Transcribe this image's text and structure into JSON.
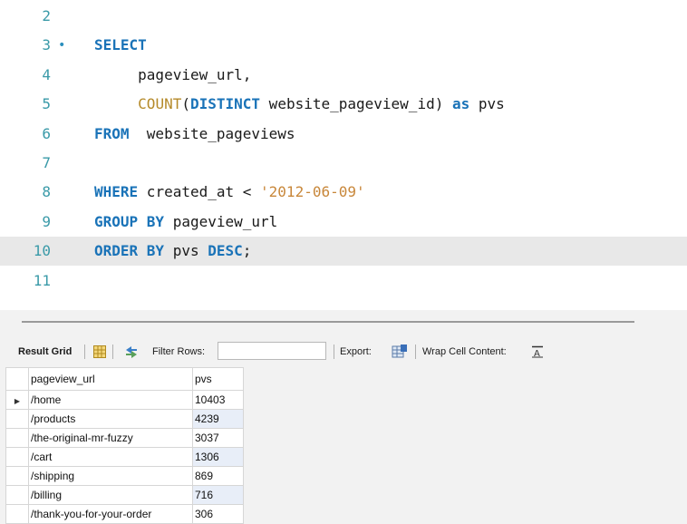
{
  "editor": {
    "lines": [
      {
        "num": "2",
        "tokens": []
      },
      {
        "num": "3",
        "tokens": [
          {
            "t": "SELECT",
            "c": "kw"
          }
        ],
        "marker": true
      },
      {
        "num": "4",
        "tokens": [
          {
            "t": "     pageview_url,",
            "c": ""
          }
        ]
      },
      {
        "num": "5",
        "tokens": [
          {
            "t": "     ",
            "c": ""
          },
          {
            "t": "COUNT",
            "c": "fn"
          },
          {
            "t": "(",
            "c": ""
          },
          {
            "t": "DISTINCT",
            "c": "kw"
          },
          {
            "t": " website_pageview_id) ",
            "c": ""
          },
          {
            "t": "as",
            "c": "kw"
          },
          {
            "t": " pvs",
            "c": ""
          }
        ]
      },
      {
        "num": "6",
        "tokens": [
          {
            "t": "FROM",
            "c": "kw"
          },
          {
            "t": "  website_pageviews",
            "c": ""
          }
        ]
      },
      {
        "num": "7",
        "tokens": []
      },
      {
        "num": "8",
        "tokens": [
          {
            "t": "WHERE",
            "c": "kw"
          },
          {
            "t": " created_at < ",
            "c": ""
          },
          {
            "t": "'2012-06-09'",
            "c": "str"
          }
        ]
      },
      {
        "num": "9",
        "tokens": [
          {
            "t": "GROUP BY",
            "c": "kw"
          },
          {
            "t": " pageview_url",
            "c": ""
          }
        ]
      },
      {
        "num": "10",
        "tokens": [
          {
            "t": "ORDER BY",
            "c": "kw"
          },
          {
            "t": " pvs ",
            "c": ""
          },
          {
            "t": "DESC",
            "c": "kw"
          },
          {
            "t": ";",
            "c": ""
          }
        ],
        "current": true
      },
      {
        "num": "11",
        "tokens": []
      }
    ],
    "marker_glyph": "•"
  },
  "toolbar": {
    "result_grid_label": "Result Grid",
    "filter_rows_label": "Filter Rows:",
    "filter_value": "",
    "export_label": "Export:",
    "wrap_label": "Wrap Cell Content:",
    "icons": [
      "grid-icon",
      "refresh-icon",
      "export-icon",
      "wrap-icon"
    ]
  },
  "grid": {
    "columns": [
      "pageview_url",
      "pvs"
    ],
    "rows": [
      [
        "/home",
        "10403"
      ],
      [
        "/products",
        "4239"
      ],
      [
        "/the-original-mr-fuzzy",
        "3037"
      ],
      [
        "/cart",
        "1306"
      ],
      [
        "/shipping",
        "869"
      ],
      [
        "/billing",
        "716"
      ],
      [
        "/thank-you-for-your-order",
        "306"
      ]
    ],
    "selected_row": 0
  },
  "colors": {
    "keyword": "#1a73b8",
    "function": "#b58a2a",
    "string": "#c8873a",
    "line_number": "#3a9aa8",
    "current_line": "#e8e8e8"
  }
}
